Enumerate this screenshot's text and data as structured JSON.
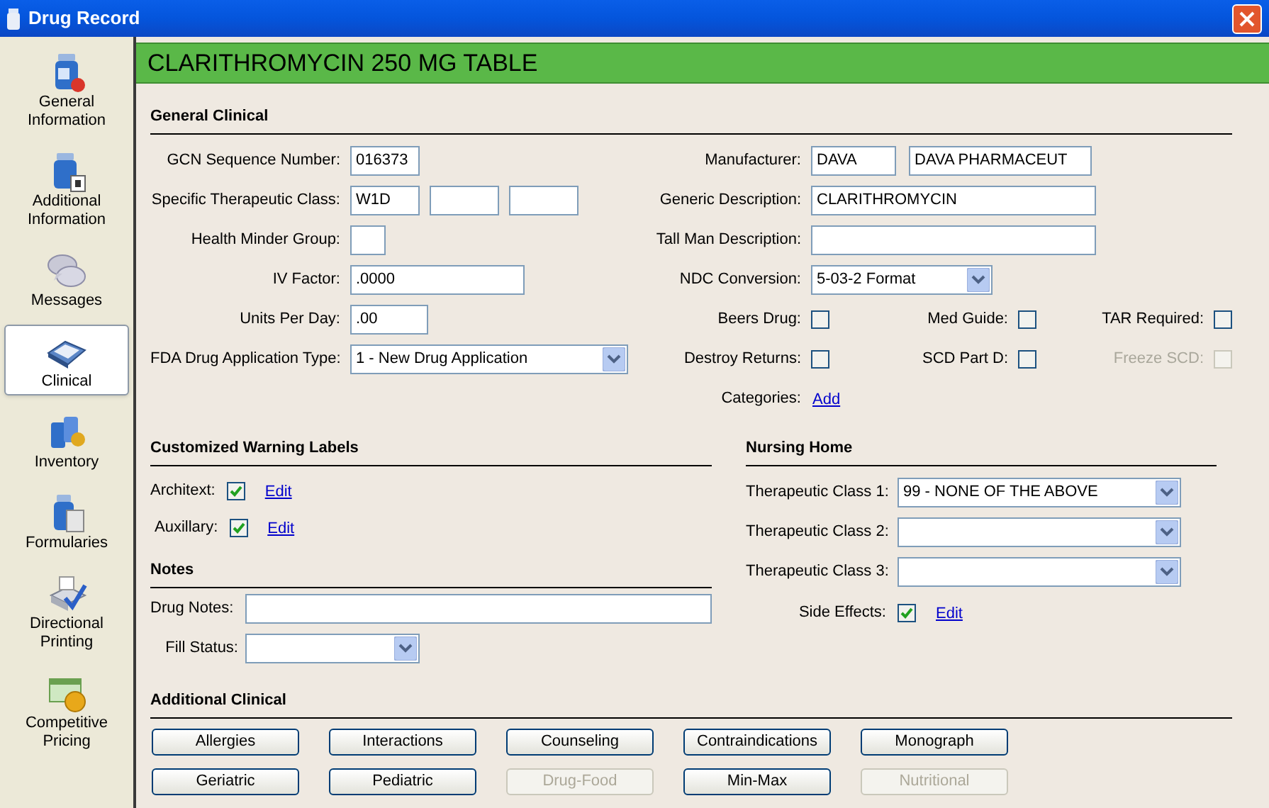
{
  "window": {
    "title": "Drug Record"
  },
  "sidebar": {
    "items": [
      {
        "kind": "bottle",
        "lines": [
          "General",
          "Information"
        ],
        "selected": false
      },
      {
        "kind": "bottle2",
        "lines": [
          "Additional",
          "Information"
        ],
        "selected": false
      },
      {
        "kind": "messages",
        "lines": [
          "Messages"
        ],
        "selected": false
      },
      {
        "kind": "clinical",
        "lines": [
          "Clinical"
        ],
        "selected": true
      },
      {
        "kind": "inventory",
        "lines": [
          "Inventory"
        ],
        "selected": false
      },
      {
        "kind": "formularies",
        "lines": [
          "Formularies"
        ],
        "selected": false
      },
      {
        "kind": "printing",
        "lines": [
          "Directional",
          "Printing"
        ],
        "selected": false
      },
      {
        "kind": "pricing",
        "lines": [
          "Competitive",
          "Pricing"
        ],
        "selected": false
      }
    ]
  },
  "header": {
    "title": "CLARITHROMYCIN 250 MG TABLE"
  },
  "general_clinical": {
    "heading": "General Clinical",
    "left_rows": [
      {
        "label": "GCN Sequence Number:",
        "kind": "fields",
        "fields": [
          {
            "value": "016373"
          }
        ]
      },
      {
        "label": "Specific Therapeutic Class:",
        "kind": "fields",
        "fields": [
          {
            "value": "W1D",
            "kind": "text"
          },
          {
            "kind": "empty"
          },
          {
            "kind": "empty"
          }
        ]
      },
      {
        "label": "Health Minder Group:",
        "kind": "fields",
        "fields": [
          {
            "kind": "empty"
          }
        ]
      },
      {
        "label": "IV Factor:",
        "kind": "fields",
        "fields": [
          {
            "value": ".0000"
          }
        ]
      },
      {
        "label": "Units Per Day:",
        "kind": "fields",
        "fields": [
          {
            "value": ".00"
          }
        ]
      },
      {
        "label": "FDA Drug Application Type:",
        "kind": "select",
        "value": "1 - New Drug Application"
      }
    ],
    "right_rows": [
      {
        "label": "Manufacturer:",
        "kind": "fields",
        "fields": [
          {
            "value": "DAVA"
          },
          {
            "value": "DAVA PHARMACEUT"
          }
        ]
      },
      {
        "label": "Generic Description:",
        "kind": "fields",
        "fields": [
          {
            "value": "CLARITHROMYCIN"
          }
        ]
      },
      {
        "label": "Tall Man Description:",
        "kind": "fields",
        "fields": [
          {
            "kind": "empty"
          }
        ]
      },
      {
        "label": "NDC Conversion:",
        "kind": "select",
        "value": "5-03-2 Format"
      },
      {
        "kind": "checks",
        "items": [
          {
            "label": "Beers Drug:",
            "checked": false,
            "disabled": false
          },
          {
            "label": "Med Guide:",
            "checked": false,
            "disabled": false
          },
          {
            "label": "TAR Required:",
            "checked": false,
            "disabled": false
          }
        ]
      },
      {
        "kind": "checks",
        "items": [
          {
            "label": "Destroy Returns:",
            "checked": false,
            "disabled": false
          },
          {
            "label": "SCD Part D:",
            "checked": false,
            "disabled": false
          },
          {
            "label": "Freeze SCD:",
            "checked": false,
            "disabled": true
          }
        ]
      },
      {
        "label": "Categories:",
        "kind": "link",
        "link": "Add"
      }
    ]
  },
  "warning_labels": {
    "heading": "Customized Warning Labels",
    "rows": [
      {
        "label": "Architext:",
        "checked": true,
        "link": "Edit"
      },
      {
        "label": "Auxillary:",
        "checked": true,
        "link": "Edit"
      }
    ]
  },
  "notes": {
    "heading": "Notes",
    "drug_notes": {
      "label": "Drug Notes:"
    },
    "fill_status": {
      "label": "Fill Status:"
    }
  },
  "nursing_home": {
    "heading": "Nursing Home",
    "selects": [
      {
        "label": "Therapeutic Class 1:",
        "value": "99 - NONE OF THE ABOVE"
      },
      {
        "label": "Therapeutic Class 2:"
      },
      {
        "label": "Therapeutic Class 3:"
      }
    ],
    "side_effects": {
      "label": "Side Effects:",
      "checked": true,
      "link": "Edit"
    }
  },
  "additional_clinical": {
    "heading": "Additional Clinical",
    "buttons": [
      {
        "label": "Allergies",
        "disabled": false
      },
      {
        "label": "Interactions",
        "disabled": false
      },
      {
        "label": "Counseling",
        "disabled": false
      },
      {
        "label": "Contraindications",
        "disabled": false
      },
      {
        "label": "Monograph",
        "disabled": false
      },
      {
        "label": "Geriatric",
        "disabled": false
      },
      {
        "label": "Pediatric",
        "disabled": false
      },
      {
        "label": "Drug-Food",
        "disabled": true
      },
      {
        "label": "Min-Max",
        "disabled": false
      },
      {
        "label": "Nutritional",
        "disabled": true
      }
    ]
  }
}
